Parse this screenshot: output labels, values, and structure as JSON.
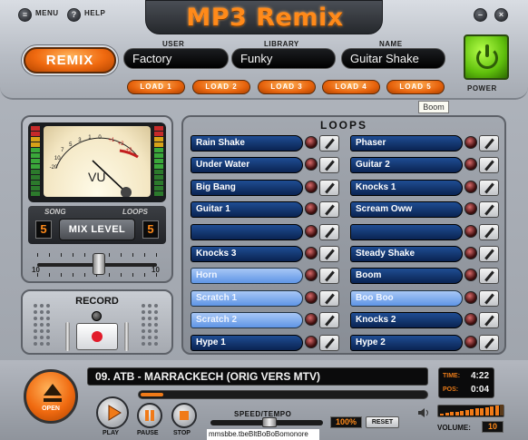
{
  "title": "MP3 Remix",
  "top": {
    "menu": "MENU",
    "help": "HELP",
    "help_glyph": "?"
  },
  "remix": "REMIX",
  "fields": {
    "user_label": "USER",
    "user_value": "Factory",
    "library_label": "LIBRARY",
    "library_value": "Funky",
    "name_label": "NAME",
    "name_value": "Guitar Shake"
  },
  "loads": [
    "LOAD 1",
    "LOAD 2",
    "LOAD 3",
    "LOAD 4",
    "LOAD 5"
  ],
  "power": "POWER",
  "tooltip": "Boom",
  "vu": {
    "label": "VU",
    "scale": [
      "-20",
      "10",
      "7",
      "5",
      "3",
      "1",
      "0",
      "+1",
      "+2",
      "+3"
    ],
    "song_label": "SONG",
    "loops_label": "LOOPS",
    "song_value": "5",
    "loops_value": "5",
    "mix_label": "MIX LEVEL",
    "slider_left": "10",
    "slider_right": "10",
    "slider_level": 0.52
  },
  "record": {
    "title": "RECORD"
  },
  "loops": {
    "title": "LOOPS",
    "left": [
      {
        "label": "Rain Shake",
        "active": false
      },
      {
        "label": "Under Water",
        "active": false
      },
      {
        "label": "Big Bang",
        "active": false
      },
      {
        "label": "Guitar 1",
        "active": false
      },
      {
        "label": "",
        "active": false
      },
      {
        "label": "Knocks 3",
        "active": false
      },
      {
        "label": "Horn",
        "active": true
      },
      {
        "label": "Scratch 1",
        "active": true
      },
      {
        "label": "Scratch 2",
        "active": true
      },
      {
        "label": "Hype 1",
        "active": false
      }
    ],
    "right": [
      {
        "label": "Phaser",
        "active": false
      },
      {
        "label": "Guitar 2",
        "active": false
      },
      {
        "label": "Knocks 1",
        "active": false
      },
      {
        "label": "Scream Oww",
        "active": false
      },
      {
        "label": "",
        "active": false
      },
      {
        "label": "Steady Shake",
        "active": false
      },
      {
        "label": "Boom",
        "active": false
      },
      {
        "label": "Boo Boo",
        "active": true
      },
      {
        "label": "Knocks 2",
        "active": false
      },
      {
        "label": "Hype 2",
        "active": false
      }
    ]
  },
  "player": {
    "track": "09. ATB - MARRACKECH (ORIG VERS MTV)",
    "progress": 0.08,
    "time_label": "TIME:",
    "time": "4:22",
    "pos_label": "POS:",
    "pos": "0:04",
    "open": "OPEN",
    "play": "PLAY",
    "pause": "PAUSE",
    "stop": "STOP",
    "speed_label": "SPEED/TEMPO",
    "speed_pct": "100%",
    "reset": "RESET",
    "volume_label": "VOLUME:",
    "volume": "10",
    "statusbar": "mmsbbe.tbeBltBoBoBomonore"
  },
  "colors": {
    "accent": "#f06a10",
    "loop": "#0f2f6a",
    "loop_active": "#7aa9ee",
    "power": "#5fbf0c"
  }
}
